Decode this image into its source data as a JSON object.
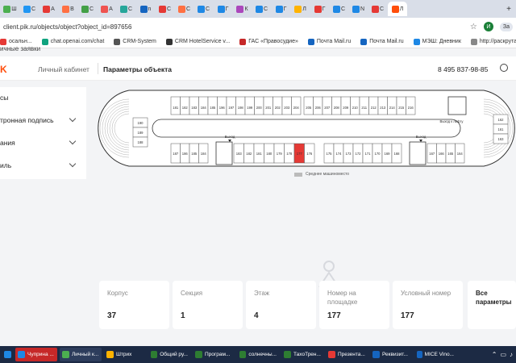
{
  "browser": {
    "tabs": [
      {
        "letter": "Ш",
        "color": "#4caf50"
      },
      {
        "letter": "С",
        "color": "#2196f3"
      },
      {
        "letter": "А",
        "color": "#e53935"
      },
      {
        "letter": "В",
        "color": "#ff7043"
      },
      {
        "letter": "С",
        "color": "#43a047"
      },
      {
        "letter": "А",
        "color": "#ef5350"
      },
      {
        "letter": "С",
        "color": "#26a69a"
      },
      {
        "letter": "n",
        "color": "#1565c0"
      },
      {
        "letter": "С",
        "color": "#e53935"
      },
      {
        "letter": "С",
        "color": "#ff7043"
      },
      {
        "letter": "С",
        "color": "#1e88e5"
      },
      {
        "letter": "Г",
        "color": "#1e88e5"
      },
      {
        "letter": "К",
        "color": "#ab47bc"
      },
      {
        "letter": "С",
        "color": "#1e88e5"
      },
      {
        "letter": "Г",
        "color": "#1e88e5"
      },
      {
        "letter": "Л",
        "color": "#ffb300"
      },
      {
        "letter": "Г",
        "color": "#e53935"
      },
      {
        "letter": "С",
        "color": "#1e88e5"
      },
      {
        "letter": "N",
        "color": "#1e88e5"
      },
      {
        "letter": "С",
        "color": "#e53935"
      },
      {
        "letter": "Л",
        "color": "#ff4e0c",
        "active": true
      }
    ],
    "new_tab": "+",
    "address": "client.pik.ru/objects/object?object_id=897656",
    "close_label": "За",
    "avatar_letter": "И"
  },
  "bookmarks": [
    {
      "label": "осальн...",
      "color": "#e53935"
    },
    {
      "label": "chat.openai.com/chat",
      "color": "#10a37f"
    },
    {
      "label": "CRM-System",
      "color": "#555555"
    },
    {
      "label": "CRM HotelService v...",
      "color": "#333333"
    },
    {
      "label": "ГАС «Правосудие»",
      "color": "#c62828"
    },
    {
      "label": "Почта Mail.ru",
      "color": "#1565c0"
    },
    {
      "label": "Почта Mail.ru",
      "color": "#1565c0"
    },
    {
      "label": "МЭШ: Дневник",
      "color": "#1e88e5"
    },
    {
      "label": "http://раскрутатех...",
      "color": "#888888"
    }
  ],
  "cut_text": "ичные заявки",
  "header": {
    "cabinet": "Личный кабинет",
    "page_title": "Параметры объекта",
    "phone": "8 495 837-98-85"
  },
  "menu": [
    {
      "label": "сы",
      "chevron": false
    },
    {
      "label": "тронная подпись",
      "chevron": true
    },
    {
      "label": "ания",
      "chevron": true
    },
    {
      "label": "иль",
      "chevron": true
    }
  ],
  "plan": {
    "top_row": [
      "181",
      "182",
      "183",
      "184",
      "185",
      "196",
      "197",
      "198",
      "199",
      "200",
      "201",
      "202",
      "203",
      "204",
      "205",
      "206",
      "207",
      "208",
      "209",
      "210",
      "211",
      "212",
      "213",
      "214",
      "215",
      "216"
    ],
    "bottom_left": [
      "187",
      "186",
      "185",
      "184"
    ],
    "bottom_mid": [
      "183",
      "182",
      "181",
      "180",
      "179",
      "178",
      "177",
      "176"
    ],
    "bottom_right": [
      "175",
      "174",
      "173",
      "172",
      "171",
      "170",
      "169",
      "168"
    ],
    "bottom_far": [
      "167",
      "166",
      "165",
      "164"
    ],
    "left_bay": [
      "190",
      "189",
      "188"
    ],
    "right_bay": [
      "162",
      "161",
      "163"
    ],
    "exit_label": "Выход",
    "elevator_label": "Выход к лифту",
    "selected": "177",
    "legend": "Среднее машиноместо",
    "selected_color": "#e53935"
  },
  "cards": [
    {
      "label": "Корпус",
      "value": "37"
    },
    {
      "label": "Секция",
      "value": "1"
    },
    {
      "label": "Этаж",
      "value": "4"
    },
    {
      "label": "Номер на площадке",
      "value": "177"
    },
    {
      "label": "Условный номер",
      "value": "177"
    }
  ],
  "params_label": "Все параметры",
  "taskbar": [
    {
      "label": "Чуприна ...",
      "color": "#1e88e5",
      "bg": "#c62828"
    },
    {
      "label": "Личный к...",
      "color": "#4caf50",
      "bg": "#2d3d5c"
    },
    {
      "label": "Штрих",
      "color": "#ffb300",
      "bg": ""
    },
    {
      "label": "Общий ру...",
      "color": "#2e7d32",
      "bg": ""
    },
    {
      "label": "Програм...",
      "color": "#2e7d32",
      "bg": ""
    },
    {
      "label": "солнечны...",
      "color": "#2e7d32",
      "bg": ""
    },
    {
      "label": "ТахоТрен...",
      "color": "#2e7d32",
      "bg": ""
    },
    {
      "label": "Презента...",
      "color": "#e53935",
      "bg": ""
    },
    {
      "label": "Реквизит...",
      "color": "#1565c0",
      "bg": ""
    },
    {
      "label": "MICE Vino...",
      "color": "#1565c0",
      "bg": ""
    }
  ]
}
